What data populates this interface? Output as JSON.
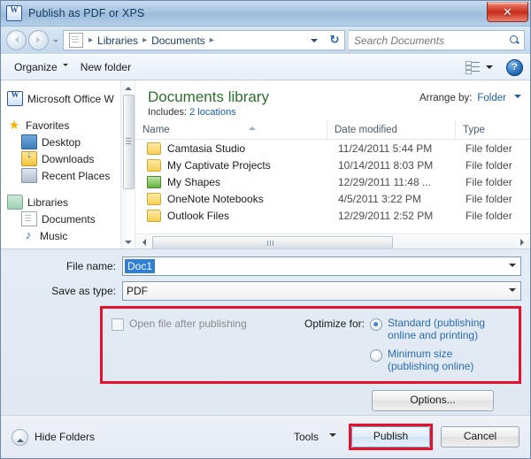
{
  "window": {
    "title": "Publish as PDF or XPS",
    "app_icon": "word-icon",
    "close_label": "✕"
  },
  "address_bar": {
    "back_icon": "back-arrow-icon",
    "forward_icon": "forward-arrow-icon",
    "history_icon": "chevron-down-icon",
    "path_icon": "documents-page-icon",
    "breadcrumbs": [
      "Libraries",
      "Documents"
    ],
    "separator": "▸",
    "dropdown_icon": "chevron-down-icon",
    "refresh_icon": "refresh-icon",
    "refresh_glyph": "↻",
    "search": {
      "placeholder": "Search Documents",
      "value": "",
      "icon": "search-icon"
    }
  },
  "toolbar": {
    "organize_label": "Organize",
    "new_folder_label": "New folder",
    "view_icon": "view-layout-icon",
    "view_caret_icon": "chevron-down-icon",
    "help_label": "?",
    "help_icon": "help-icon"
  },
  "sidebar": {
    "items": [
      {
        "label": "Microsoft Office W",
        "icon": "word-icon",
        "indent": false
      },
      {
        "label": "Favorites",
        "icon": "star-icon",
        "indent": false
      },
      {
        "label": "Desktop",
        "icon": "desktop-icon",
        "indent": true
      },
      {
        "label": "Downloads",
        "icon": "downloads-folder-icon",
        "indent": true
      },
      {
        "label": "Recent Places",
        "icon": "recent-places-icon",
        "indent": true
      },
      {
        "label": "Libraries",
        "icon": "libraries-icon",
        "indent": false
      },
      {
        "label": "Documents",
        "icon": "document-icon",
        "indent": true
      },
      {
        "label": "Music",
        "icon": "music-note-icon",
        "indent": true
      }
    ],
    "scrollbar": {
      "up_icon": "scroll-up-arrow-icon",
      "down_icon": "scroll-down-arrow-icon"
    }
  },
  "library": {
    "title": "Documents library",
    "includes_label": "Includes:",
    "includes_link": "2 locations",
    "arrange_label": "Arrange by:",
    "arrange_value": "Folder",
    "arrange_caret_icon": "chevron-down-icon"
  },
  "file_list": {
    "columns": [
      "Name",
      "Date modified",
      "Type"
    ],
    "sort_indicator": "sort-ascending-icon",
    "rows": [
      {
        "name": "Camtasia Studio",
        "date": "11/24/2011 5:44 PM",
        "type": "File folder",
        "icon": "folder-icon"
      },
      {
        "name": "My Captivate Projects",
        "date": "10/14/2011 8:03 PM",
        "type": "File folder",
        "icon": "folder-icon"
      },
      {
        "name": "My Shapes",
        "date": "12/29/2011 11:48 ...",
        "type": "File folder",
        "icon": "shapes-folder-icon"
      },
      {
        "name": "OneNote Notebooks",
        "date": "4/5/2011 3:22 PM",
        "type": "File folder",
        "icon": "folder-icon"
      },
      {
        "name": "Outlook Files",
        "date": "12/29/2011 2:52 PM",
        "type": "File folder",
        "icon": "folder-icon"
      }
    ],
    "hscroll": {
      "left_icon": "scroll-left-arrow-icon",
      "right_icon": "scroll-right-arrow-icon"
    }
  },
  "fields": {
    "file_name_label": "File name:",
    "file_name_value": "Doc1",
    "file_name_dropdown_icon": "chevron-down-icon",
    "save_type_label": "Save as type:",
    "save_type_value": "PDF",
    "save_type_dropdown_icon": "chevron-down-icon"
  },
  "options_panel": {
    "highlight_color": "#e8112d",
    "open_after_label": "Open file after publishing",
    "open_after_checked": false,
    "optimize_label": "Optimize for:",
    "radios": [
      {
        "line1": "Standard (publishing",
        "line2": "online and printing)",
        "selected": true
      },
      {
        "line1": "Minimum size",
        "line2": "(publishing online)",
        "selected": false
      }
    ],
    "options_button": "Options..."
  },
  "footer": {
    "hide_folders_label": "Hide Folders",
    "hide_folders_icon": "collapse-up-icon",
    "tools_label": "Tools",
    "tools_caret_icon": "chevron-down-icon",
    "publish_label": "Publish",
    "cancel_label": "Cancel",
    "publish_highlight_color": "#e8112d"
  }
}
